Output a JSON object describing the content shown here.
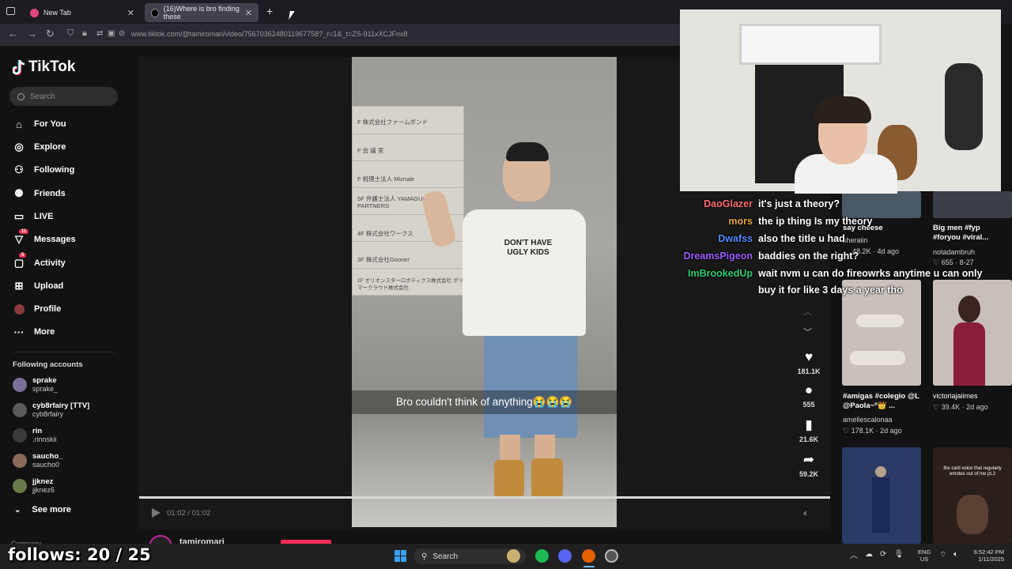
{
  "browser": {
    "tabs": [
      {
        "label": "New Tab",
        "active": false
      },
      {
        "label": "(16)Where is bro finding these",
        "active": true
      }
    ],
    "new_tab_icon": "+",
    "url": "www.tiktok.com/@tamiromari/video/7567036248011967758?_r=1&_t=ZS-911xXCJFnx8"
  },
  "tiktok": {
    "brand": "TikTok",
    "search_placeholder": "Search",
    "nav": [
      {
        "label": "For You",
        "icon": "home-icon"
      },
      {
        "label": "Explore",
        "icon": "compass-icon"
      },
      {
        "label": "Following",
        "icon": "following-icon"
      },
      {
        "label": "Friends",
        "icon": "friends-icon"
      },
      {
        "label": "LIVE",
        "icon": "live-icon"
      },
      {
        "label": "Messages",
        "icon": "messages-icon",
        "badge": "11"
      },
      {
        "label": "Activity",
        "icon": "activity-icon",
        "badge": "5"
      },
      {
        "label": "Upload",
        "icon": "upload-icon"
      },
      {
        "label": "Profile",
        "icon": "avatar"
      },
      {
        "label": "More",
        "icon": "more-icon"
      }
    ],
    "following_header": "Following accounts",
    "following": [
      {
        "name": "sprake",
        "handle": "sprake_",
        "color": "#7a6f9b"
      },
      {
        "name": "cyb8rfairy [TTV]",
        "handle": "cyb8rfairy",
        "color": "#5a5a5a"
      },
      {
        "name": "rin",
        "handle": ".rinnskii",
        "color": "#3a3a3a"
      },
      {
        "name": "saucho_",
        "handle": "saucho0",
        "color": "#8b6a5a"
      },
      {
        "name": "jjknez",
        "handle": "jjknez6",
        "color": "#6b7a4a"
      }
    ],
    "see_more": "See more",
    "company": "Company"
  },
  "video": {
    "caption": "Bro couldn't think of anything😭😭😭",
    "shirt_text": "DON'T HAVE UGLY KIDS",
    "sign_lines": [
      "F 株式会社ファームボンド",
      "F 会 議 室",
      "F 税理士法人 Miznale",
      "5F 弁護士法人 YAMAGUCHI & PARTNERS",
      "4F 株式会社ワークス",
      "3F 株式会社Gooner",
      "2F オリオンスターロボティクス株式会社 ポリマークラウド株式会社"
    ],
    "time": "01:02 / 01:02",
    "progress": 1.0,
    "author": "tamiromari"
  },
  "actions": {
    "likes": "181.1K",
    "comments": "555",
    "saves": "21.6K",
    "shares": "59.2K"
  },
  "chat": [
    {
      "user": "DaoGlazer",
      "color": "#ff6e6e",
      "message": "it's just a theory?"
    },
    {
      "user": "mors",
      "color": "#e8a33c",
      "message": "the ip thing Is my theory"
    },
    {
      "user": "Dwafss",
      "color": "#4f8bff",
      "message": "also the title u had"
    },
    {
      "user": "DreamsPigeon",
      "color": "#9b5cff",
      "message": "baddies on the right?"
    },
    {
      "user": "ImBrookedUp",
      "color": "#2ecc71",
      "message": "wait nvm u can do fireowrks anytime u can only buy it for like 3 days a year tho"
    }
  ],
  "recommended": [
    {
      "title": "say cheese",
      "author": "sheraiin",
      "stats": "48.2K · 4d ago",
      "color": "#4a5866"
    },
    {
      "title": "Big men #fyp #foryou #viral...",
      "author": "notadambruh",
      "stats": "♡ 655 · 8-27",
      "color": "#3b4048"
    },
    {
      "title": "#amigas #colegio @L @Paola~º👑 ...",
      "author": "ameliescalonaa",
      "stats": "♡ 178.1K · 2d ago",
      "color": "#c9c0bb"
    },
    {
      "title": "",
      "author": "victoriajaiimes",
      "stats": "♡ 39.4K · 2d ago",
      "color": "#c8bfb9"
    },
    {
      "title": "",
      "author": "",
      "stats": "",
      "color": "#2a3a66"
    },
    {
      "title": "the carti voice that regularly emotes out of me pt.2",
      "author": "",
      "stats": "",
      "color": "#2a1f1a"
    }
  ],
  "overlay": {
    "follows": "follows: 20 / 25"
  },
  "taskbar": {
    "search": "Search",
    "lang": [
      "ENG",
      "US"
    ],
    "time": "6:52:42 PM",
    "date": "1/11/2025"
  }
}
